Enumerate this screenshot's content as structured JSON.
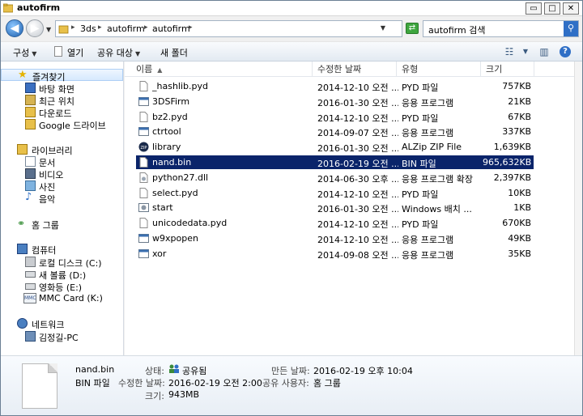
{
  "window": {
    "title": "autofirm",
    "controls": {
      "minimize": "▭",
      "maximize": "□",
      "close": "✕"
    }
  },
  "address": {
    "crumbs": [
      "3ds",
      "autofirm",
      "autofirm"
    ],
    "separator": "▸",
    "search_text": "autofirm 검색"
  },
  "toolbar": {
    "organize": "구성",
    "open": "열기",
    "share": "공유 대상",
    "new_folder": "새 폴더",
    "dropdown_glyph": "▼"
  },
  "sidebar": {
    "favorites": {
      "label": "즐겨찾기",
      "items": [
        "바탕 화면",
        "최근 위치",
        "다운로드",
        "Google 드라이브"
      ]
    },
    "libraries": {
      "label": "라이브러리",
      "items": [
        "문서",
        "비디오",
        "사진",
        "음악"
      ]
    },
    "homegroup": {
      "label": "홈 그룹"
    },
    "computer": {
      "label": "컴퓨터",
      "items": [
        "로컬 디스크 (C:)",
        "새 볼륨 (D:)",
        "영화등 (E:)",
        "MMC Card (K:)"
      ]
    },
    "network": {
      "label": "네트워크",
      "items": [
        "김정길-PC"
      ]
    }
  },
  "columns": {
    "name": "이름",
    "date": "수정한 날짜",
    "type": "유형",
    "size": "크기",
    "sort_glyph": "▲"
  },
  "files": [
    {
      "name": "_hashlib.pyd",
      "date": "2014-12-10 오전 ...",
      "type": "PYD 파일",
      "size": "757KB",
      "icon": "generic-file-icon"
    },
    {
      "name": "3DSFirm",
      "date": "2016-01-30 오전 ...",
      "type": "응용 프로그램",
      "size": "21KB",
      "icon": "application-icon"
    },
    {
      "name": "bz2.pyd",
      "date": "2014-12-10 오전 ...",
      "type": "PYD 파일",
      "size": "67KB",
      "icon": "generic-file-icon"
    },
    {
      "name": "ctrtool",
      "date": "2014-09-07 오전 ...",
      "type": "응용 프로그램",
      "size": "337KB",
      "icon": "application-icon"
    },
    {
      "name": "library",
      "date": "2016-01-30 오전 ...",
      "type": "ALZip ZIP File",
      "size": "1,639KB",
      "icon": "zip-icon"
    },
    {
      "name": "nand.bin",
      "date": "2016-02-19 오전 ...",
      "type": "BIN 파일",
      "size": "965,632KB",
      "icon": "generic-file-icon",
      "selected": true
    },
    {
      "name": "python27.dll",
      "date": "2014-06-30 오후 ...",
      "type": "응용 프로그램 확장",
      "size": "2,397KB",
      "icon": "dll-icon"
    },
    {
      "name": "select.pyd",
      "date": "2014-12-10 오전 ...",
      "type": "PYD 파일",
      "size": "10KB",
      "icon": "generic-file-icon"
    },
    {
      "name": "start",
      "date": "2016-01-30 오전 ...",
      "type": "Windows 배치 ...",
      "size": "1KB",
      "icon": "batch-icon"
    },
    {
      "name": "unicodedata.pyd",
      "date": "2014-12-10 오전 ...",
      "type": "PYD 파일",
      "size": "670KB",
      "icon": "generic-file-icon"
    },
    {
      "name": "w9xpopen",
      "date": "2014-12-10 오전 ...",
      "type": "응용 프로그램",
      "size": "49KB",
      "icon": "application-icon"
    },
    {
      "name": "xor",
      "date": "2014-09-08 오전 ...",
      "type": "응용 프로그램",
      "size": "35KB",
      "icon": "application-icon"
    }
  ],
  "details": {
    "filename": "nand.bin",
    "filetype": "BIN 파일",
    "status_label": "상태:",
    "status_value": "공유됨",
    "modified_label": "수정한 날짜:",
    "modified_value": "2016-02-19 오전 2:00",
    "size_label": "크기:",
    "size_value": "943MB",
    "created_label": "만든 날짜:",
    "created_value": "2016-02-19 오후 10:04",
    "shared_label": "공유 사용자:",
    "shared_value": "홈 그룹"
  },
  "colors": {
    "selection": "#0a246a",
    "accent": "#2f6fc6"
  }
}
